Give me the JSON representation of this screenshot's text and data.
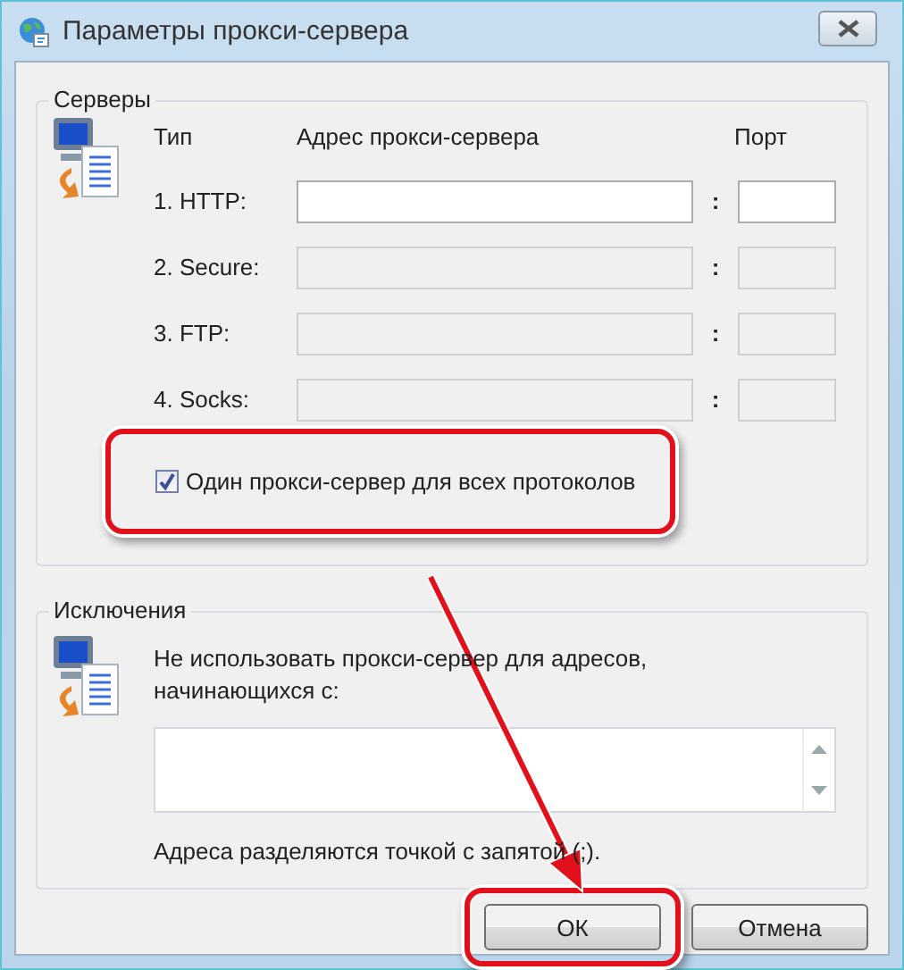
{
  "window": {
    "title": "Параметры прокси-сервера"
  },
  "servers": {
    "title": "Серверы",
    "headers": {
      "type": "Тип",
      "address": "Адрес прокси-сервера",
      "port": "Порт"
    },
    "rows": [
      {
        "label": "1. HTTP:",
        "separator": ":",
        "disabled": false
      },
      {
        "label": "2. Secure:",
        "separator": ":",
        "disabled": true
      },
      {
        "label": "3. FTP:",
        "separator": ":",
        "disabled": true
      },
      {
        "label": "4. Socks:",
        "separator": ":",
        "disabled": true
      }
    ],
    "same_proxy": {
      "label": "Один прокси-сервер для всех протоколов",
      "checked": true,
      "highlighted": true
    }
  },
  "exceptions": {
    "title": "Исключения",
    "prompt": "Не использовать прокси-сервер для адресов, начинающихся с:",
    "note": "Адреса разделяются точкой с запятой (;)."
  },
  "buttons": [
    {
      "label": "ОК",
      "highlighted": true
    },
    {
      "label": "Отмена",
      "highlighted": false
    }
  ]
}
